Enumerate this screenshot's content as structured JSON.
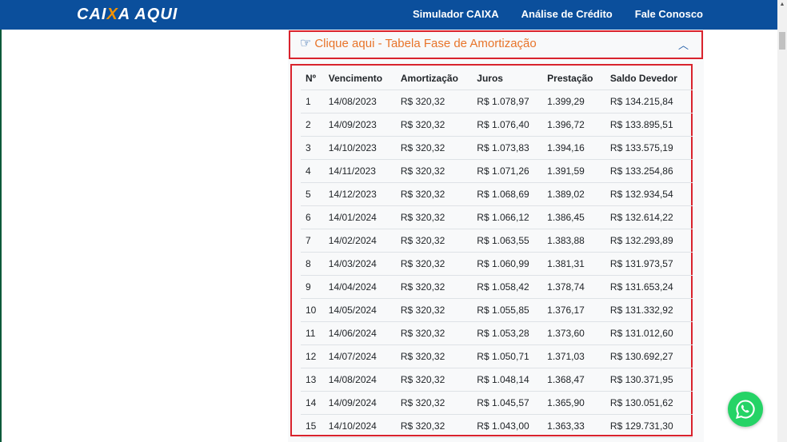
{
  "nav": {
    "logo_a": "CAI",
    "logo_x": "X",
    "logo_b": "A AQUI",
    "links": [
      "Simulador CAIXA",
      "Análise de Crédito",
      "Fale Conosco"
    ]
  },
  "accordion": {
    "title": "Clique aqui - Tabela Fase de Amortização",
    "icon": "hand-pointing-icon",
    "expanded": true
  },
  "table": {
    "headers": [
      "Nº",
      "Vencimento",
      "Amortização",
      "Juros",
      "Prestação",
      "Saldo Devedor"
    ],
    "rows": [
      [
        "1",
        "14/08/2023",
        "R$ 320,32",
        "R$ 1.078,97",
        "1.399,29",
        "R$ 134.215,84"
      ],
      [
        "2",
        "14/09/2023",
        "R$ 320,32",
        "R$ 1.076,40",
        "1.396,72",
        "R$ 133.895,51"
      ],
      [
        "3",
        "14/10/2023",
        "R$ 320,32",
        "R$ 1.073,83",
        "1.394,16",
        "R$ 133.575,19"
      ],
      [
        "4",
        "14/11/2023",
        "R$ 320,32",
        "R$ 1.071,26",
        "1.391,59",
        "R$ 133.254,86"
      ],
      [
        "5",
        "14/12/2023",
        "R$ 320,32",
        "R$ 1.068,69",
        "1.389,02",
        "R$ 132.934,54"
      ],
      [
        "6",
        "14/01/2024",
        "R$ 320,32",
        "R$ 1.066,12",
        "1.386,45",
        "R$ 132.614,22"
      ],
      [
        "7",
        "14/02/2024",
        "R$ 320,32",
        "R$ 1.063,55",
        "1.383,88",
        "R$ 132.293,89"
      ],
      [
        "8",
        "14/03/2024",
        "R$ 320,32",
        "R$ 1.060,99",
        "1.381,31",
        "R$ 131.973,57"
      ],
      [
        "9",
        "14/04/2024",
        "R$ 320,32",
        "R$ 1.058,42",
        "1.378,74",
        "R$ 131.653,24"
      ],
      [
        "10",
        "14/05/2024",
        "R$ 320,32",
        "R$ 1.055,85",
        "1.376,17",
        "R$ 131.332,92"
      ],
      [
        "11",
        "14/06/2024",
        "R$ 320,32",
        "R$ 1.053,28",
        "1.373,60",
        "R$ 131.012,60"
      ],
      [
        "12",
        "14/07/2024",
        "R$ 320,32",
        "R$ 1.050,71",
        "1.371,03",
        "R$ 130.692,27"
      ],
      [
        "13",
        "14/08/2024",
        "R$ 320,32",
        "R$ 1.048,14",
        "1.368,47",
        "R$ 130.371,95"
      ],
      [
        "14",
        "14/09/2024",
        "R$ 320,32",
        "R$ 1.045,57",
        "1.365,90",
        "R$ 130.051,62"
      ],
      [
        "15",
        "14/10/2024",
        "R$ 320,32",
        "R$ 1.043,00",
        "1.363,33",
        "R$ 129.731,30"
      ]
    ]
  },
  "colors": {
    "nav": "#0b4f9c",
    "accent": "#e8742a",
    "highlight": "#d9232d",
    "whatsapp": "#25d366"
  }
}
